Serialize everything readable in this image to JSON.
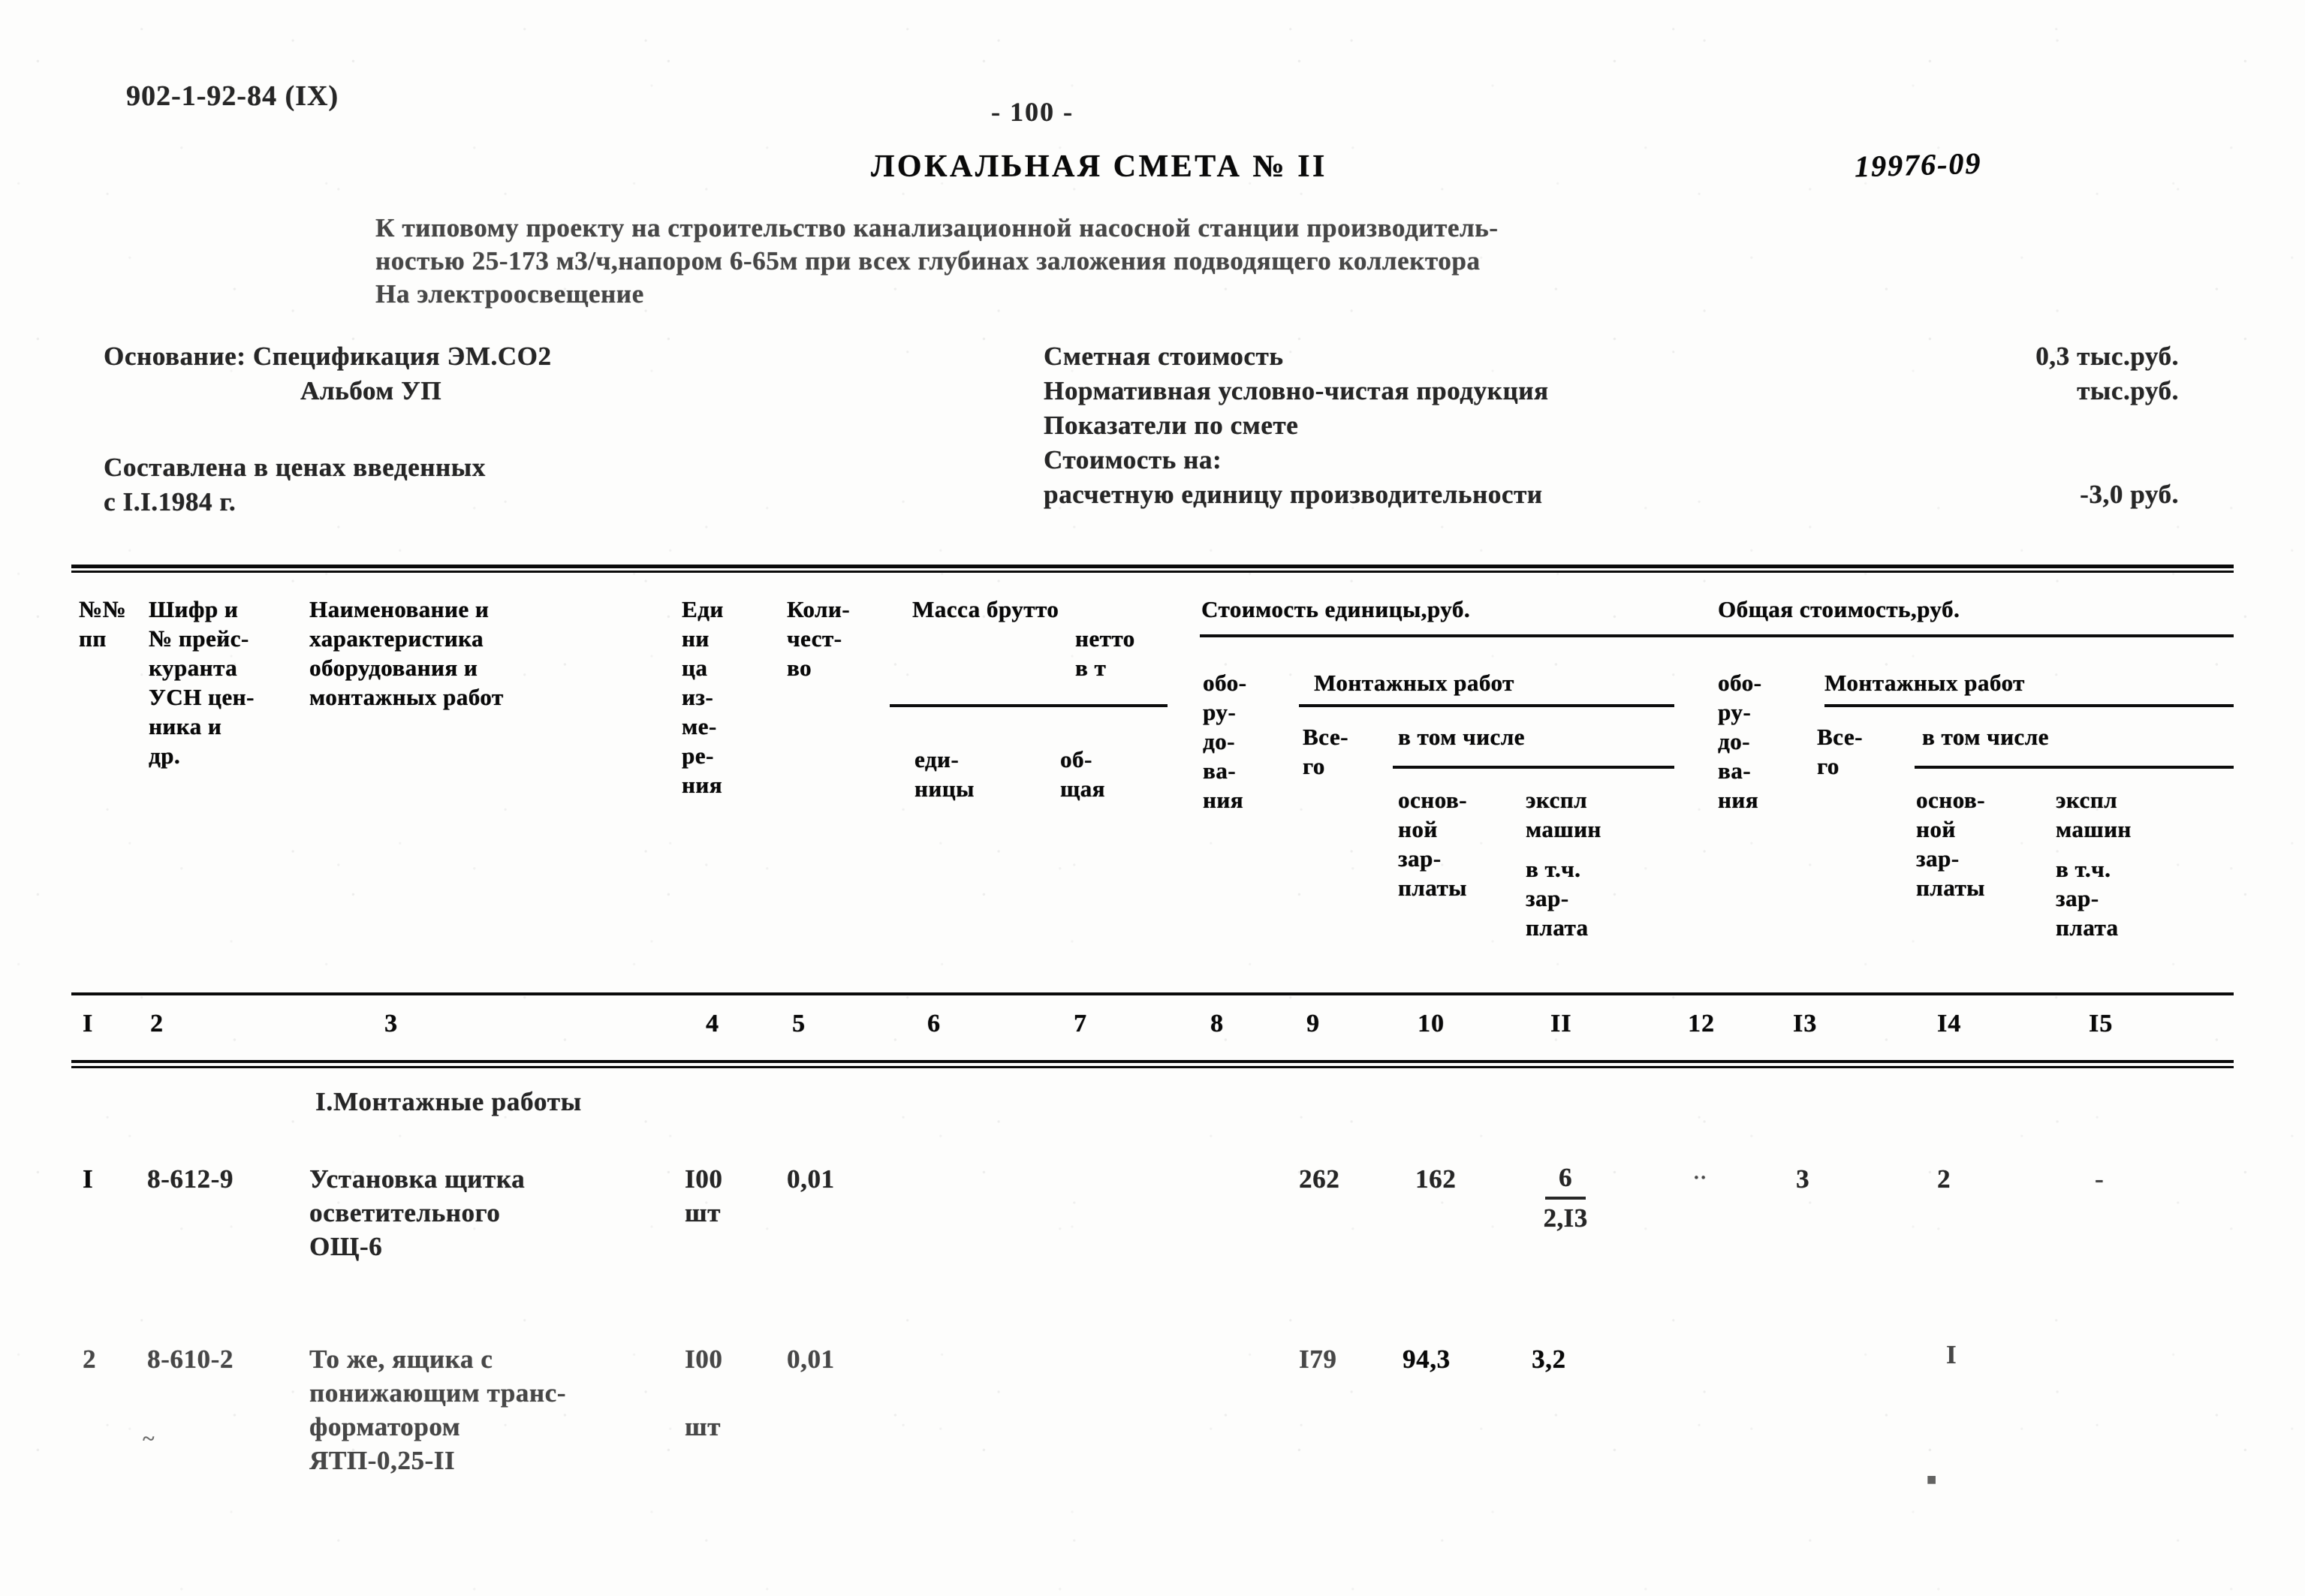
{
  "document": {
    "series_code": "902-1-92-84 (IX)",
    "page_number": "- 100 -",
    "title": "ЛОКАЛЬНАЯ СМЕТА № II",
    "registration_number": "19976-09",
    "intro_line1": "К типовому проекту на строительство канализационной насосной станции производитель-",
    "intro_line2": "ностью 25-173 м3/ч,напором 6-65м при всех глубинах заложения подводящего коллектора",
    "intro_line3": "На электроосвещение"
  },
  "basis": {
    "label": "Основание:",
    "value_line1": "Спецификация ЭМ.СО2",
    "value_line2": "Альбом УП",
    "prices_line1": "Составлена в ценах введенных",
    "prices_line2": "с I.I.1984 г."
  },
  "costs": {
    "estimate_label": "Сметная стоимость",
    "estimate_value": "0,3 тыс.руб.",
    "npcp_label": "Нормативная условно-чистая продукция",
    "npcp_value": "тыс.руб.",
    "indicators_label": "Показатели по смете",
    "cost_on_label": "Стоимость на:",
    "unit_label": "расчетную единицу производительности",
    "unit_value": "-3,0 руб."
  },
  "table": {
    "headers": {
      "col1": "№№\nпп",
      "col1_l1": "№№",
      "col1_l2": "пп",
      "col2_l1": "Шифр и",
      "col2_l2": "№ прейс-",
      "col2_l3": "куранта",
      "col2_l4": "УСН цен-",
      "col2_l5": "ника и",
      "col2_l6": "др.",
      "col3_l1": "Наименование и",
      "col3_l2": "характеристика",
      "col3_l3": "оборудования и",
      "col3_l4": "монтажных работ",
      "col4_l1": "Еди",
      "col4_l2": "ни",
      "col4_l3": "ца",
      "col4_l4": "из-",
      "col4_l5": "ме-",
      "col4_l6": "ре-",
      "col4_l7": "ния",
      "col5_l1": "Коли-",
      "col5_l2": "чест-",
      "col5_l3": "во",
      "mass_group": "Масса брутто",
      "mass_l2": "нетто",
      "mass_l3": "в т",
      "col6_l1": "еди-",
      "col6_l2": "ницы",
      "col7_l1": "об-",
      "col7_l2": "щая",
      "unit_cost_group": "Стоимость единицы,руб.",
      "total_cost_group": "Общая стоимость,руб.",
      "equip_l1": "обо-",
      "equip_l2": "ру-",
      "equip_l3": "до-",
      "equip_l4": "ва-",
      "equip_l5": "ния",
      "install_group": "Монтажных работ",
      "total_l1": "Все-",
      "total_l2": "го",
      "among_which": "в том числе",
      "basic_l1": "основ-",
      "basic_l2": "ной",
      "basic_l3": "зар-",
      "basic_l4": "платы",
      "machines_l1": "экспл",
      "machines_l2": "машин",
      "machines_l3": "в т.ч.",
      "machines_l4": "зар-",
      "machines_l5": "плата"
    },
    "column_numbers": [
      "I",
      "2",
      "3",
      "4",
      "5",
      "6",
      "7",
      "8",
      "9",
      "10",
      "II",
      "12",
      "I3",
      "I4",
      "I5"
    ],
    "section_title": "I.Монтажные работы",
    "rows": [
      {
        "no": "I",
        "code": "8-612-9",
        "name_l1": "Установка щитка",
        "name_l2": "осветительного",
        "name_l3": "ОЩ-6",
        "unit_l1": "I00",
        "unit_l2": "шт",
        "qty": "0,01",
        "mass_unit": "",
        "mass_total": "",
        "equip_unit": "",
        "install_total": "262",
        "install_basic": "162",
        "install_machines_num": "6",
        "install_machines_den": "2,I3",
        "equip_sum": "",
        "sum_total": "3",
        "sum_basic": "2",
        "sum_machines": "-"
      },
      {
        "no": "2",
        "code": "8-610-2",
        "name_l1": "То же, ящика с",
        "name_l2": "понижающим транс-",
        "name_l3": "форматором",
        "name_l4": "ЯТП-0,25-II",
        "unit_l1": "I00",
        "unit_l2": "шт",
        "qty": "0,01",
        "mass_unit": "",
        "mass_total": "",
        "equip_unit": "",
        "install_total": "I79",
        "install_basic": "94,3",
        "install_machines_num": "3,2",
        "install_machines_den": "",
        "equip_sum": "",
        "sum_total": "I",
        "sum_basic": "",
        "sum_machines": ""
      }
    ]
  }
}
